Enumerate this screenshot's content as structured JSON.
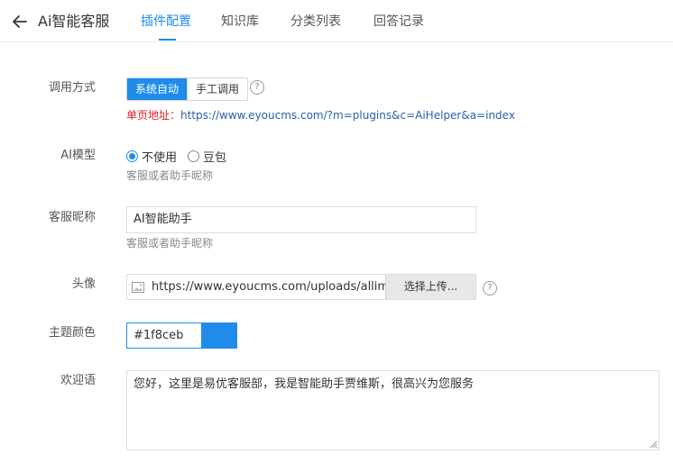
{
  "header": {
    "title": "Ai智能客服",
    "tabs": [
      {
        "label": "插件配置",
        "active": true
      },
      {
        "label": "知识库",
        "active": false
      },
      {
        "label": "分类列表",
        "active": false
      },
      {
        "label": "回答记录",
        "active": false
      }
    ]
  },
  "form": {
    "call_mode": {
      "label": "调用方式",
      "options": [
        "系统自动",
        "手工调用"
      ],
      "selected": "系统自动",
      "url_prefix": "单页地址：",
      "url": "https://www.eyoucms.com/?m=plugins&c=AiHelper&a=index"
    },
    "ai_model": {
      "label": "AI模型",
      "options": [
        "不使用",
        "豆包"
      ],
      "selected": "不使用",
      "hint": "客服或者助手昵称"
    },
    "nickname": {
      "label": "客服昵称",
      "value": "AI智能助手",
      "hint": "客服或者助手昵称"
    },
    "avatar": {
      "label": "头像",
      "value": "https://www.eyoucms.com/uploads/allimg",
      "button": "选择上传..."
    },
    "theme_color": {
      "label": "主题颜色",
      "value": "#1f8ceb"
    },
    "welcome": {
      "label": "欢迎语",
      "value": "您好，这里是易优客服部，我是智能助手贾维斯，很高兴为您服务"
    }
  },
  "icons": {
    "back": "arrow-left-icon",
    "help": "question-circle-icon",
    "image": "image-icon"
  },
  "colors": {
    "accent": "#1f8ceb",
    "link": "#2a5fa8",
    "warning": "#e02020"
  }
}
